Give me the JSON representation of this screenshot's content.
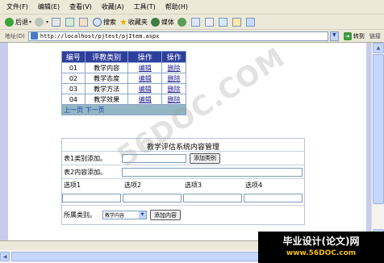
{
  "menu": [
    "文件(F)",
    "编辑(E)",
    "查看(V)",
    "收藏(A)",
    "工具(T)",
    "帮助(H)"
  ],
  "toolbar": {
    "back": "后退",
    "search": "搜索",
    "favorites": "收藏夹",
    "media": "媒体"
  },
  "address": {
    "label": "地址(D)",
    "url": "http://localhost/pjtest/pjItem.aspx",
    "go": "转到",
    "links": "链接"
  },
  "table": {
    "headers": [
      "编号",
      "评教类别",
      "操作",
      "操作"
    ],
    "rows": [
      {
        "id": "01",
        "category": "教学内容",
        "edit": "编辑",
        "del": "删除"
      },
      {
        "id": "02",
        "category": "教学态度",
        "edit": "编辑",
        "del": "删除"
      },
      {
        "id": "03",
        "category": "教学方法",
        "edit": "编辑",
        "del": "删除"
      },
      {
        "id": "04",
        "category": "教学效果",
        "edit": "编辑",
        "del": "删除"
      }
    ],
    "prev": "上一页",
    "next": "下一页"
  },
  "form": {
    "title": "教学评估系统内容管理",
    "table1_label": "表1类别添加。",
    "add_category": "添加类别",
    "table2_label": "表2内容添加。",
    "options": [
      "选项1",
      "选项2",
      "选项3",
      "选项4"
    ],
    "category_label": "所属类别。",
    "category_value": "教学内容",
    "add_content": "添加内容"
  },
  "watermark": "56DOC.COM",
  "badge": {
    "title": "毕业设计(论文)网",
    "url": "www.56DOC.com"
  }
}
